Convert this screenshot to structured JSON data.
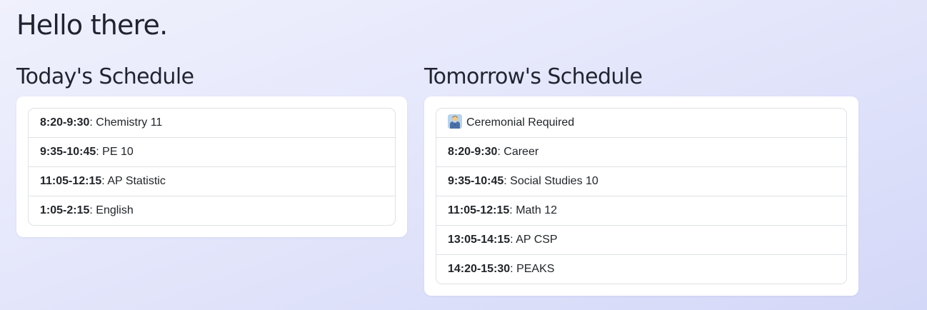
{
  "greeting": "Hello there.",
  "today": {
    "title": "Today's Schedule",
    "items": [
      {
        "time": "8:20-9:30",
        "sep": ": ",
        "name": "Chemistry 11"
      },
      {
        "time": "9:35-10:45",
        "sep": ": ",
        "name": "PE 10"
      },
      {
        "time": "11:05-12:15",
        "sep": ": ",
        "name": "AP Statistic"
      },
      {
        "time": "1:05-2:15",
        "sep": ": ",
        "name": "English"
      }
    ]
  },
  "tomorrow": {
    "title": "Tomorrow's Schedule",
    "notice": {
      "icon": "person-in-suit-emoji-icon",
      "text": "Ceremonial Required"
    },
    "items": [
      {
        "time": "8:20-9:30",
        "sep": ": ",
        "name": "Career"
      },
      {
        "time": "9:35-10:45",
        "sep": ": ",
        "name": "Social Studies 10"
      },
      {
        "time": "11:05-12:15",
        "sep": ": ",
        "name": "Math 12"
      },
      {
        "time": "13:05-14:15",
        "sep": ": ",
        "name": "AP CSP"
      },
      {
        "time": "14:20-15:30",
        "sep": ": ",
        "name": "PEAKS"
      }
    ]
  }
}
